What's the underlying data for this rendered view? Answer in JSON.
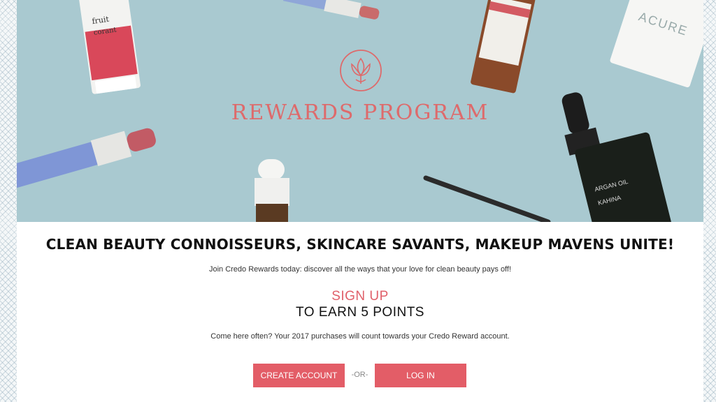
{
  "hero": {
    "title": "REWARDS PROGRAM",
    "logo_icon": "lotus-icon",
    "accent_color": "#de6a6b",
    "background_color": "#a9c9d0",
    "product_labels": {
      "tube_top": "fruit",
      "tube_top_sub": "corant",
      "acure": "ACURE",
      "argan": "ARGAN OIL",
      "kahina": "KAHINA"
    }
  },
  "content": {
    "headline": "CLEAN BEAUTY CONNOISSEURS, SKINCARE SAVANTS, MAKEUP MAVENS UNITE!",
    "intro": "Join Credo Rewards today: discover all the ways that your love for clean beauty pays off!",
    "signup": "SIGN UP",
    "earn": "TO EARN 5 POINTS",
    "note": "Come here often? Your 2017 purchases will count towards your Credo Reward account."
  },
  "actions": {
    "create_account": "CREATE ACCOUNT",
    "or": "-OR-",
    "log_in": "LOG IN",
    "button_color": "#e35d67"
  }
}
